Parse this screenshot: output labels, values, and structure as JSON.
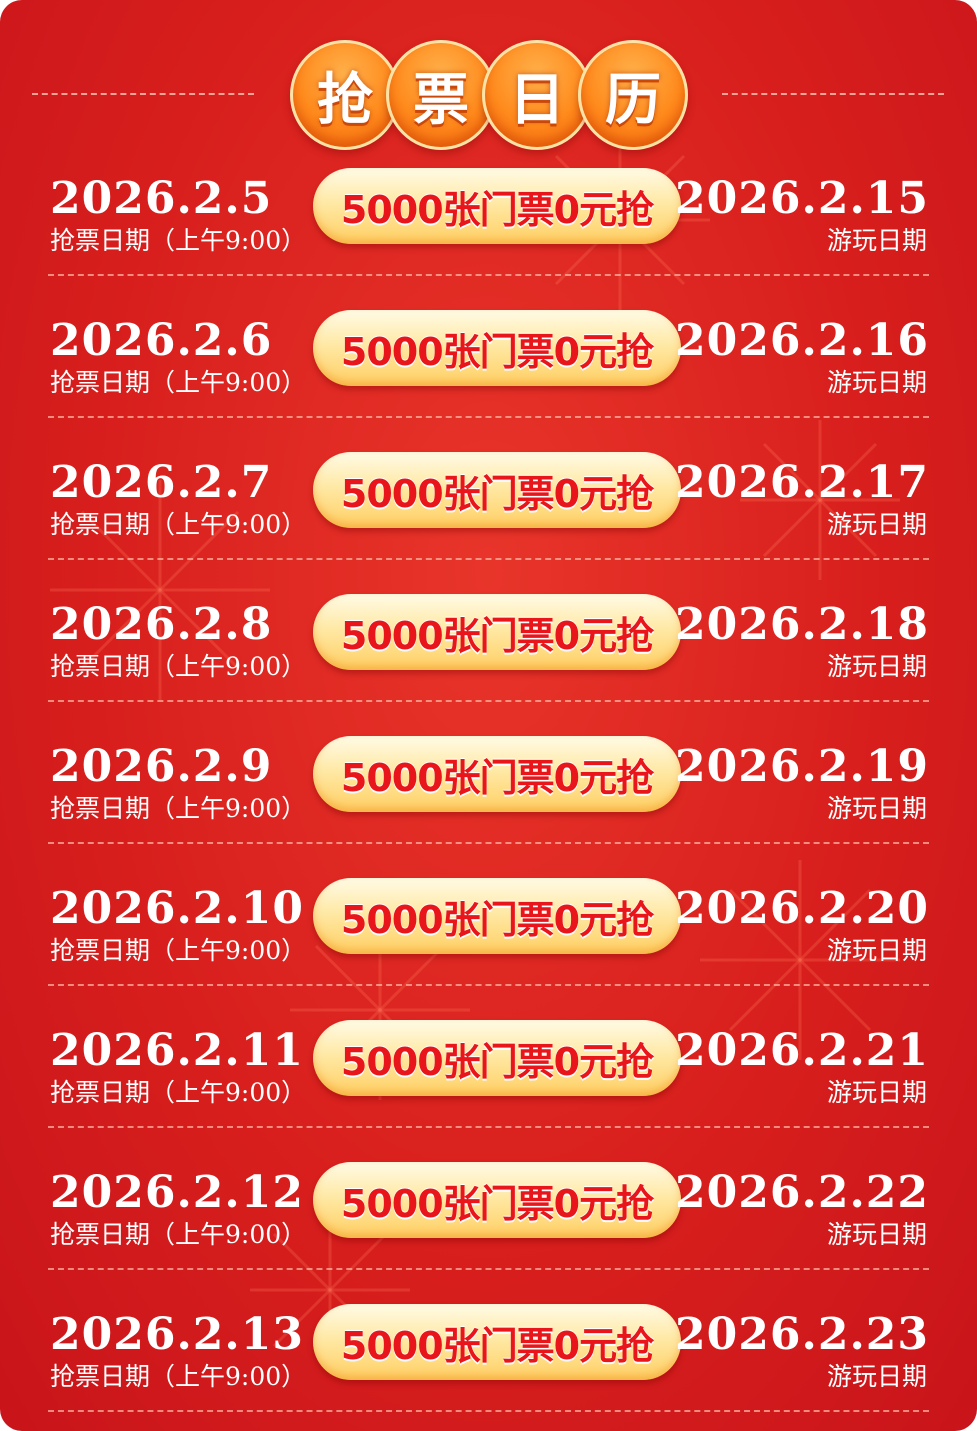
{
  "header": {
    "title_chars": [
      "抢",
      "票",
      "日",
      "历"
    ]
  },
  "rows": [
    {
      "grab_date": "2026.2.5",
      "grab_label": "抢票日期（上午9:00）",
      "offer": "5000张门票0元抢",
      "play_date": "2026.2.15",
      "play_label": "游玩日期"
    },
    {
      "grab_date": "2026.2.6",
      "grab_label": "抢票日期（上午9:00）",
      "offer": "5000张门票0元抢",
      "play_date": "2026.2.16",
      "play_label": "游玩日期"
    },
    {
      "grab_date": "2026.2.7",
      "grab_label": "抢票日期（上午9:00）",
      "offer": "5000张门票0元抢",
      "play_date": "2026.2.17",
      "play_label": "游玩日期"
    },
    {
      "grab_date": "2026.2.8",
      "grab_label": "抢票日期（上午9:00）",
      "offer": "5000张门票0元抢",
      "play_date": "2026.2.18",
      "play_label": "游玩日期"
    },
    {
      "grab_date": "2026.2.9",
      "grab_label": "抢票日期（上午9:00）",
      "offer": "5000张门票0元抢",
      "play_date": "2026.2.19",
      "play_label": "游玩日期"
    },
    {
      "grab_date": "2026.2.10",
      "grab_label": "抢票日期（上午9:00）",
      "offer": "5000张门票0元抢",
      "play_date": "2026.2.20",
      "play_label": "游玩日期"
    },
    {
      "grab_date": "2026.2.11",
      "grab_label": "抢票日期（上午9:00）",
      "offer": "5000张门票0元抢",
      "play_date": "2026.2.21",
      "play_label": "游玩日期"
    },
    {
      "grab_date": "2026.2.12",
      "grab_label": "抢票日期（上午9:00）",
      "offer": "5000张门票0元抢",
      "play_date": "2026.2.22",
      "play_label": "游玩日期"
    },
    {
      "grab_date": "2026.2.13",
      "grab_label": "抢票日期（上午9:00）",
      "offer": "5000张门票0元抢",
      "play_date": "2026.2.23",
      "play_label": "游玩日期"
    }
  ],
  "colors": {
    "background": "#d81f1d",
    "badge": "#ff8a1c",
    "pill": "#ffe9a6",
    "offer_text": "#e8151b",
    "text": "#ffffff"
  }
}
